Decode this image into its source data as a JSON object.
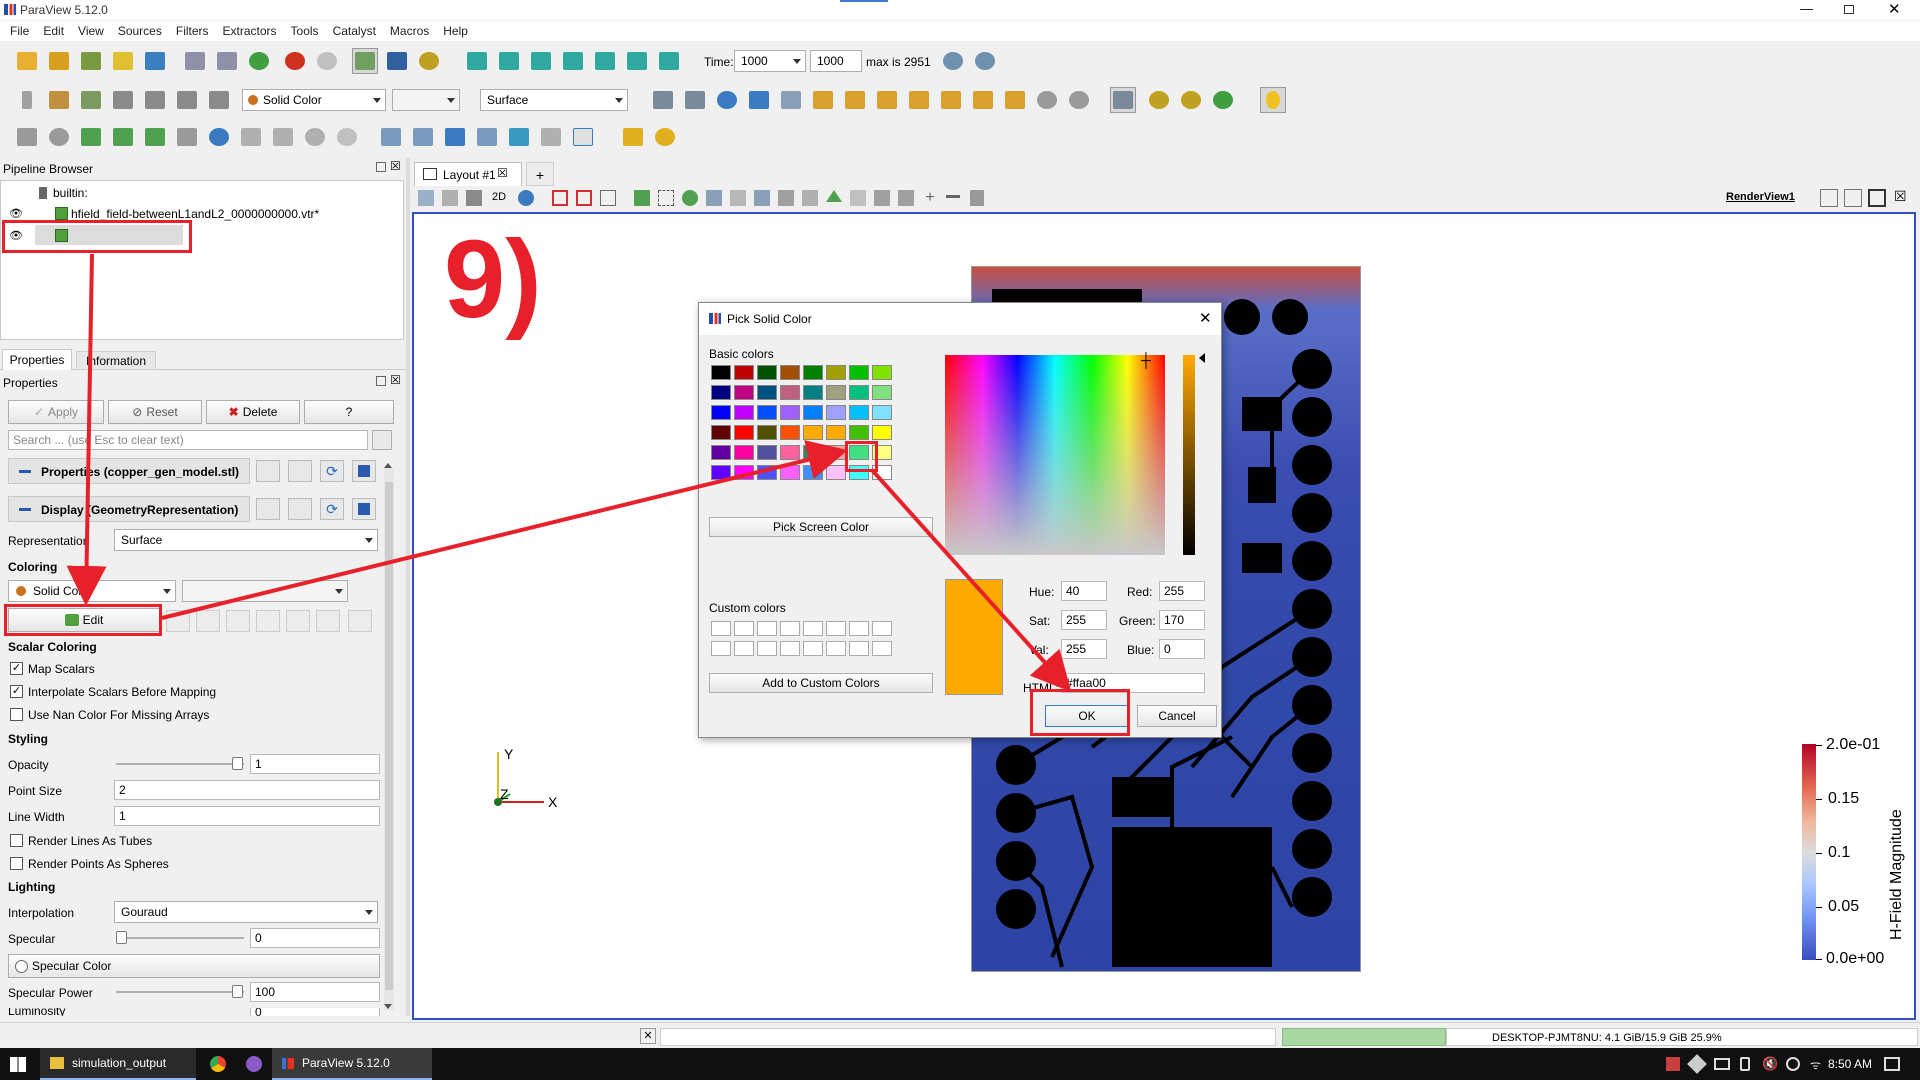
{
  "app": {
    "title": "ParaView 5.12.0"
  },
  "menu": [
    "File",
    "Edit",
    "View",
    "Sources",
    "Filters",
    "Extractors",
    "Tools",
    "Catalyst",
    "Macros",
    "Help"
  ],
  "time": {
    "label": "Time:",
    "value": "1000",
    "index": "1000",
    "max": "max is 2951"
  },
  "toolbar2": {
    "color_mode": "Solid Color",
    "representation": "Surface"
  },
  "pipeline": {
    "title": "Pipeline Browser",
    "root": "builtin:",
    "item1": "hfield_field-betweenL1andL2_0000000000.vtr*",
    "item2": ""
  },
  "tabs": {
    "properties": "Properties",
    "information": "Information"
  },
  "props": {
    "title": "Properties",
    "apply": "Apply",
    "reset": "Reset",
    "delete": "Delete",
    "help": "?",
    "search_placeholder": "Search ... (use Esc to clear text)",
    "sec_properties": "Properties (copper_gen_model.stl)",
    "sec_display": "Display (GeometryRepresentation)",
    "representation_label": "Representation",
    "representation_value": "Surface",
    "coloring": "Coloring",
    "coloring_value": "Solid Color",
    "edit": "Edit",
    "scalar_coloring": "Scalar Coloring",
    "map_scalars": "Map Scalars",
    "interpolate": "Interpolate Scalars Before Mapping",
    "nan_color": "Use Nan Color For Missing Arrays",
    "styling": "Styling",
    "opacity_label": "Opacity",
    "opacity": "1",
    "point_size_label": "Point Size",
    "point_size": "2",
    "line_width_label": "Line Width",
    "line_width": "1",
    "tubes": "Render Lines As Tubes",
    "spheres": "Render Points As Spheres",
    "lighting": "Lighting",
    "interpolation_label": "Interpolation",
    "interpolation": "Gouraud",
    "specular_label": "Specular",
    "specular": "0",
    "specular_color": "Specular Color",
    "specular_power_label": "Specular Power",
    "specular_power": "100",
    "luminosity_label": "Luminosity",
    "luminosity": "0"
  },
  "layout": {
    "tab": "Layout #1",
    "plus": "+",
    "view_name": "RenderView1",
    "mode2d": "2D"
  },
  "step_label": "9)",
  "dialog": {
    "title": "Pick Solid Color",
    "basic_colors": "Basic colors",
    "pick_screen": "Pick Screen Color",
    "custom_colors": "Custom colors",
    "add_custom": "Add to Custom Colors",
    "hue_label": "Hue:",
    "hue": "40",
    "sat_label": "Sat:",
    "sat": "255",
    "val_label": "Val:",
    "val": "255",
    "red_label": "Red:",
    "red": "255",
    "green_label": "Green:",
    "green": "170",
    "blue_label": "Blue:",
    "blue": "0",
    "html_label": "HTML:",
    "html": "#ffaa00",
    "ok": "OK",
    "cancel": "Cancel",
    "selected_color": "#ffaa00",
    "swatches": [
      [
        "#000000",
        "#c00000",
        "#005000",
        "#a05000",
        "#008000",
        "#a0a000",
        "#00c000",
        "#80e000"
      ],
      [
        "#000080",
        "#c00080",
        "#005080",
        "#c06080",
        "#008080",
        "#a0a080",
        "#00c080",
        "#80e080"
      ],
      [
        "#0000ff",
        "#c000ff",
        "#0050ff",
        "#a060ff",
        "#0080ff",
        "#a0a0ff",
        "#00c0ff",
        "#80e0ff"
      ],
      [
        "#600000",
        "#ff0000",
        "#505000",
        "#ff5000",
        "#ffaa00",
        "#ffaa00",
        "#40c000",
        "#ffff00"
      ],
      [
        "#6000a0",
        "#ff00a0",
        "#5050a0",
        "#ff60a0",
        "#408060",
        "#ffa0a0",
        "#40e080",
        "#ffff80"
      ],
      [
        "#6000ff",
        "#ff00ff",
        "#5050ff",
        "#ff60ff",
        "#4090ff",
        "#ffc0ff",
        "#40ffff",
        "#ffffff"
      ]
    ]
  },
  "colorbar": {
    "title": "H-Field Magnitude",
    "ticks": [
      "2.0e-01",
      "0.15",
      "0.1",
      "0.05",
      "0.0e+00"
    ]
  },
  "axes": {
    "x": "X",
    "y": "Y",
    "z": "Z"
  },
  "status": {
    "memory": "DESKTOP-PJMT8NU: 4.1 GiB/15.9 GiB 25.9%"
  },
  "taskbar": {
    "explorer": "simulation_output",
    "paraview": "ParaView 5.12.0",
    "time": "8:50 AM"
  }
}
